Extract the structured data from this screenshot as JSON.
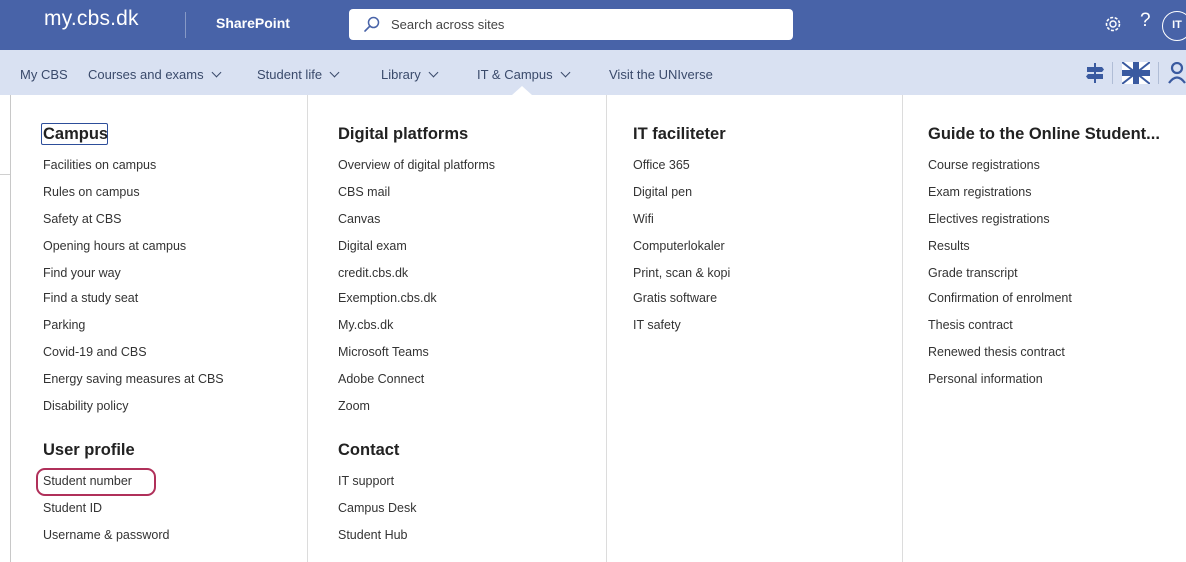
{
  "suite_bar": {
    "site_name": "my.cbs.dk",
    "app_name": "SharePoint",
    "search_placeholder": "Search across sites",
    "help_label": "?",
    "avatar_initials": "IT",
    "background": "#4863a8"
  },
  "nav": {
    "background": "#d9e1f2",
    "items": [
      {
        "label": "My CBS",
        "dropdown": false
      },
      {
        "label": "Courses and exams",
        "dropdown": true
      },
      {
        "label": "Student life",
        "dropdown": true
      },
      {
        "label": "Library",
        "dropdown": true
      },
      {
        "label": "IT & Campus",
        "dropdown": true,
        "active": true
      },
      {
        "label": "Visit the UNIverse",
        "dropdown": false
      }
    ],
    "tools": [
      "signpost-icon",
      "uk-flag-icon",
      "person-icon"
    ]
  },
  "menu": {
    "columns": [
      {
        "sections": [
          {
            "heading": "Campus",
            "links": [
              "Facilities on campus",
              "Rules on campus",
              "Safety at CBS",
              "Opening hours at campus",
              "Find your way",
              "Find a study seat",
              "Parking",
              "Covid-19 and CBS",
              "Energy saving measures at CBS",
              "Disability policy"
            ]
          },
          {
            "heading": "User profile",
            "links": [
              "Student number",
              "Student ID",
              "Username & password"
            ]
          }
        ]
      },
      {
        "sections": [
          {
            "heading": "Digital platforms",
            "links": [
              "Overview of digital platforms",
              "CBS mail",
              "Canvas",
              "Digital exam",
              "credit.cbs.dk",
              "Exemption.cbs.dk",
              "My.cbs.dk",
              "Microsoft Teams",
              "Adobe Connect",
              "Zoom"
            ]
          },
          {
            "heading": "Contact",
            "links": [
              "IT support",
              "Campus Desk",
              "Student Hub"
            ]
          }
        ]
      },
      {
        "sections": [
          {
            "heading": "IT faciliteter",
            "links": [
              "Office 365",
              "Digital pen",
              "Wifi",
              "Computerlokaler",
              "Print, scan & kopi",
              "Gratis software",
              "IT safety"
            ]
          }
        ]
      },
      {
        "sections": [
          {
            "heading": "Guide to the Online Student...",
            "links": [
              "Course registrations",
              "Exam registrations",
              "Electives registrations",
              "Results",
              "Grade transcript",
              "Confirmation of enrolment",
              "Thesis contract",
              "Renewed thesis contract",
              "Personal information"
            ]
          }
        ]
      }
    ],
    "highlighted_link": "Student number",
    "highlight_color": "#b0305a"
  }
}
